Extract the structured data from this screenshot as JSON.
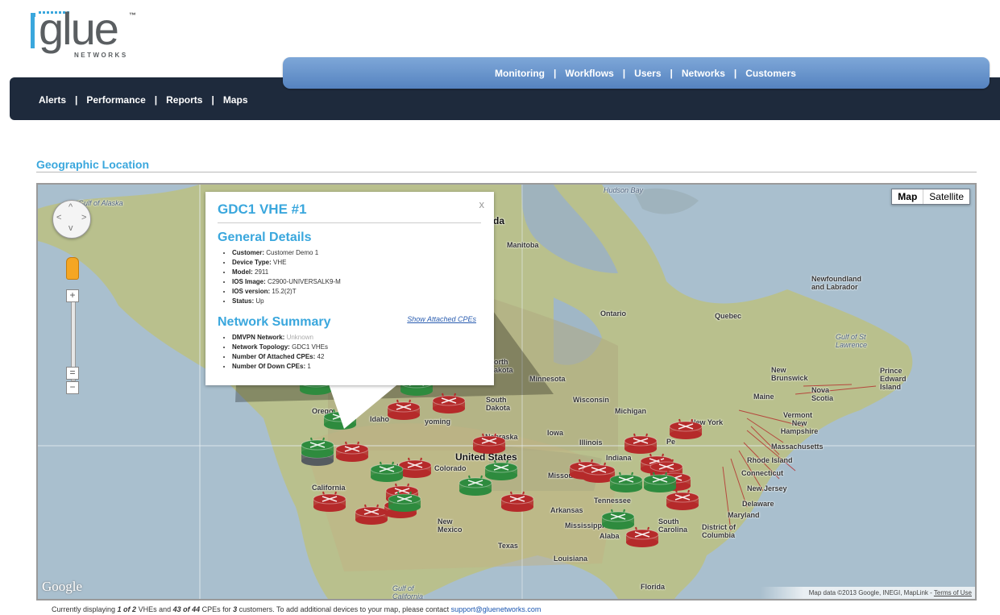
{
  "brand": {
    "logo_word": "glue",
    "logo_sub": "NETWORKS",
    "logo_tm": "™"
  },
  "top_nav": [
    {
      "label": "Monitoring"
    },
    {
      "label": "Workflows"
    },
    {
      "label": "Users"
    },
    {
      "label": "Networks"
    },
    {
      "label": "Customers"
    }
  ],
  "sub_nav": [
    {
      "label": "Alerts"
    },
    {
      "label": "Performance"
    },
    {
      "label": "Reports"
    },
    {
      "label": "Maps"
    }
  ],
  "section_title": "Geographic Location",
  "map": {
    "type_buttons": {
      "map": "Map",
      "satellite": "Satellite"
    },
    "google_logo": "Google",
    "attribution": "Map data ©2013 Google, INEGI, MapLink - ",
    "terms": "Terms of Use",
    "colors": {
      "device_up": "#2e8b3e",
      "device_down": "#b52a2a",
      "device_selected": "#555b60"
    },
    "labels": {
      "gulf_alaska": "Gulf of Alaska",
      "hudson_bay": "Hudson Bay",
      "manitoba": "Manitoba",
      "ontario": "Ontario",
      "quebec": "Quebec",
      "newfoundland": "Newfoundland and Labrador",
      "gulf_st_lawrence": "Gulf of St Lawrence",
      "new_brunswick": "New Brunswick",
      "pei": "Prince Edward Island",
      "nova_scotia": "Nova Scotia",
      "maine": "Maine",
      "vermont": "Vermont",
      "new_hampshire": "New Hampshire",
      "massachusetts": "Massachusetts",
      "rhode_island": "Rhode Island",
      "connecticut": "Connecticut",
      "new_jersey": "New Jersey",
      "delaware": "Delaware",
      "maryland": "Maryland",
      "dc": "District of Columbia",
      "new_york": "New York",
      "north_dakota": "orth akota",
      "south_dakota": "South Dakota",
      "minnesota": "Minnesota",
      "wisconsin": "Wisconsin",
      "michigan": "Michigan",
      "iowa": "Iowa",
      "illinois": "Illinois",
      "indiana": "Indiana",
      "pennsylvania": "Pe",
      "oregon": "Orego",
      "idaho": "Idaho",
      "wyoming": "yoming",
      "nebraska": "Nebraska",
      "united_states": "United States",
      "colorado": "Colorado",
      "utah": "Uta",
      "california": "California",
      "missouri": "Missou",
      "tennessee": "Tennessee",
      "arkansas": "Arkansas",
      "mississippi": "Mississippi",
      "alabama": "Alaba",
      "south_carolina": "South Carolina",
      "new_mexico": "New Mexico",
      "texas": "Texas",
      "louisiana": "Louisiana",
      "florida": "Florida",
      "gulf_california": "Gulf of California",
      "canada_fragment": "da"
    }
  },
  "popup": {
    "title": "GDC1 VHE #1",
    "close": "x",
    "general_heading": "General Details",
    "general": [
      {
        "key": "Customer:",
        "value": "Customer Demo 1"
      },
      {
        "key": "Device Type:",
        "value": "VHE"
      },
      {
        "key": "Model:",
        "value": "2911"
      },
      {
        "key": "IOS Image:",
        "value": "C2900-UNIVERSALK9-M"
      },
      {
        "key": "IOS version:",
        "value": "15.2(2)T"
      },
      {
        "key": "Status:",
        "value": "Up"
      }
    ],
    "network_heading": "Network Summary",
    "show_link": "Show Attached CPEs",
    "network": [
      {
        "key": "DMVPN Network:",
        "value": "Unknown"
      },
      {
        "key": "Network Topology:",
        "value": "GDC1 VHEs"
      },
      {
        "key": "Number Of Attached CPEs:",
        "value": "42"
      },
      {
        "key": "Number Of Down CPEs:",
        "value": "1"
      }
    ]
  },
  "footer": {
    "text_1": "Currently displaying ",
    "vhe_count": "1 of 2",
    "text_2": " VHEs and ",
    "cpe_count": "43 of 44",
    "text_3": " CPEs for ",
    "customer_count": "3",
    "text_4": " customers. To add additional devices to your map, please contact ",
    "email": "support@gluenetworks.com"
  }
}
